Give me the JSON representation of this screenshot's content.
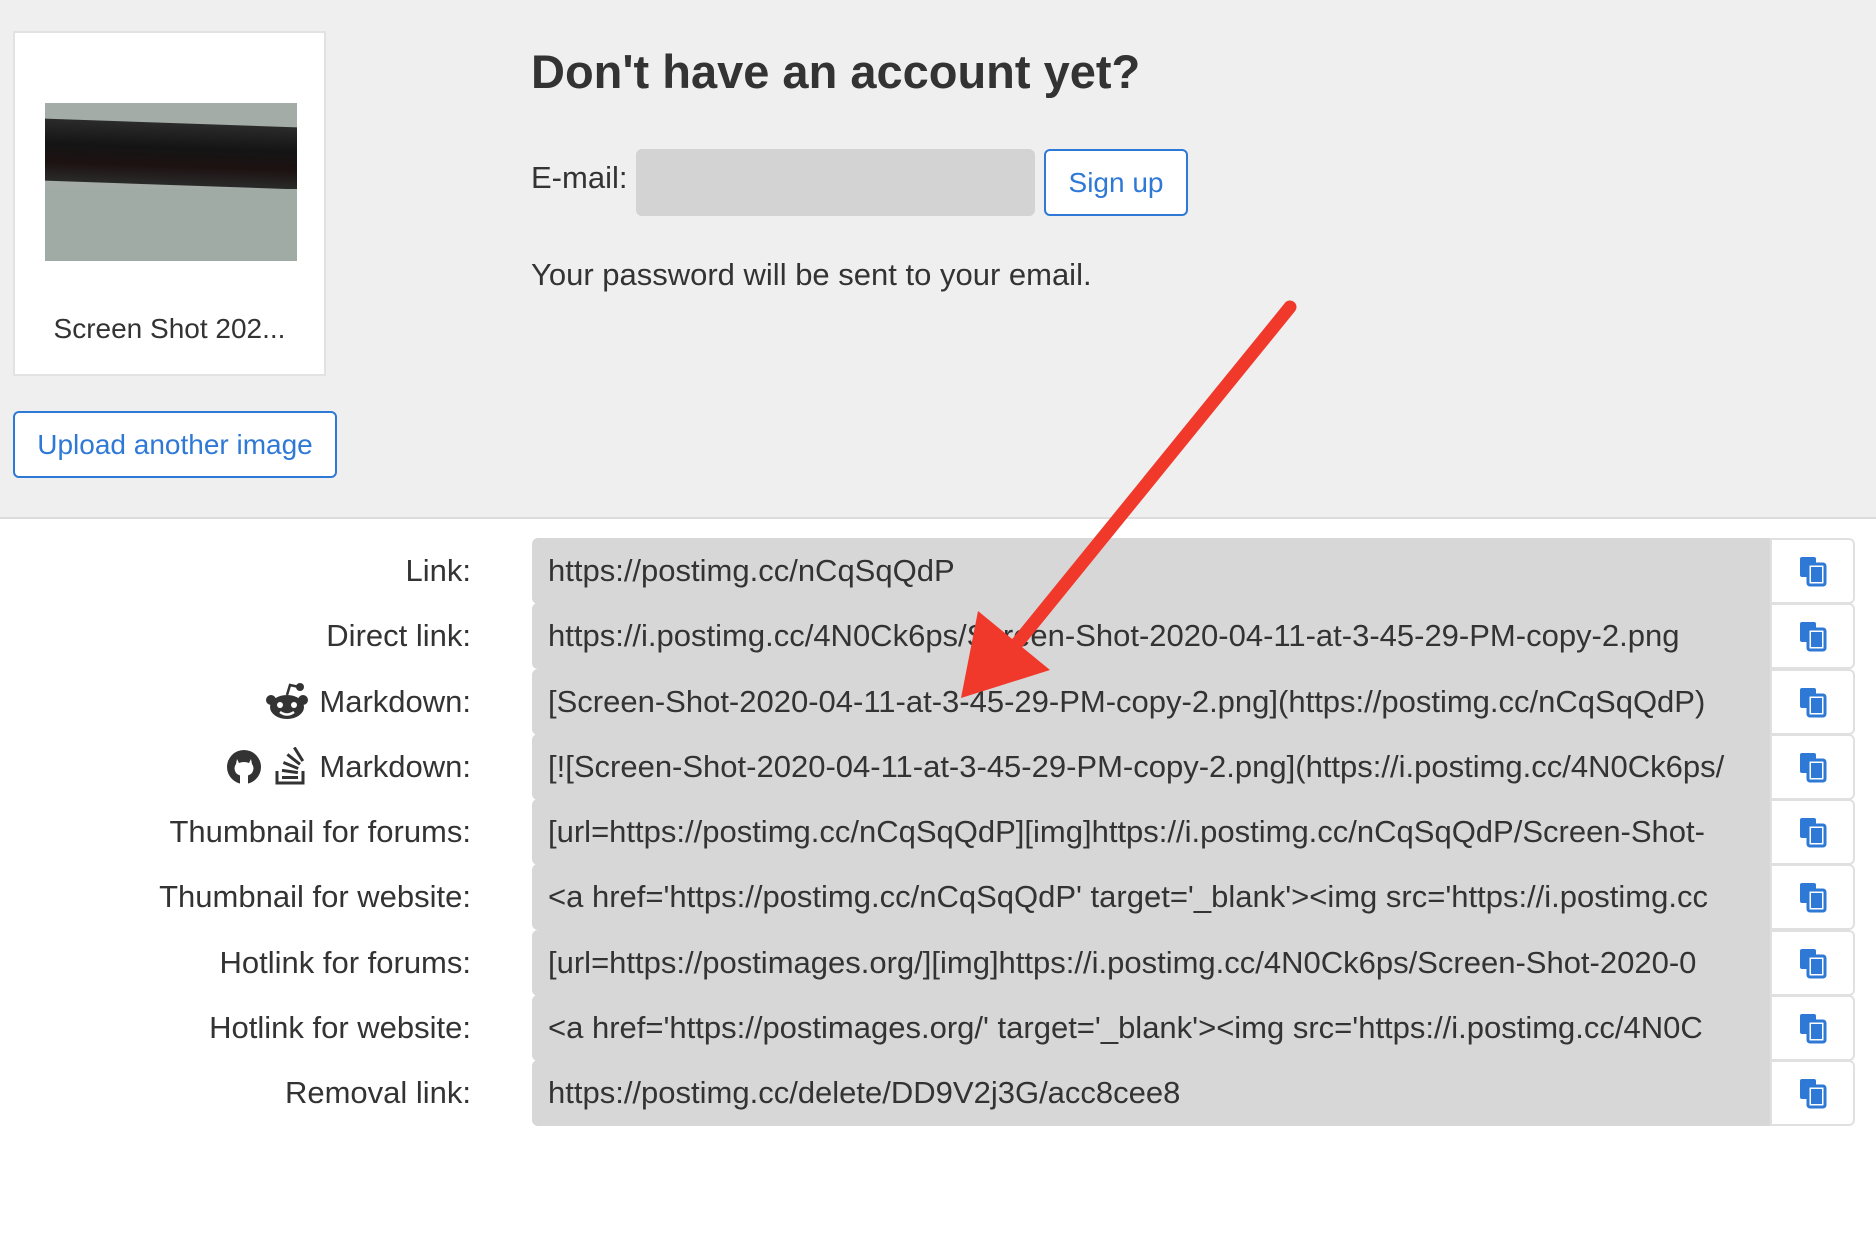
{
  "upload_panel": {
    "thumbnail_caption": "Screen Shot 202...",
    "upload_button_label": "Upload another image"
  },
  "signup": {
    "heading": "Don't have an account yet?",
    "email_label": "E-mail:",
    "email_value": "",
    "signup_button_label": "Sign up",
    "note": "Your password will be sent to your email."
  },
  "links": [
    {
      "label": "Link:",
      "value": "https://postimg.cc/nCqSqQdP",
      "icons": []
    },
    {
      "label": "Direct link:",
      "value": "https://i.postimg.cc/4N0Ck6ps/Screen-Shot-2020-04-11-at-3-45-29-PM-copy-2.png",
      "icons": []
    },
    {
      "label": "Markdown:",
      "value": "[Screen-Shot-2020-04-11-at-3-45-29-PM-copy-2.png](https://postimg.cc/nCqSqQdP)",
      "icons": [
        "reddit-icon"
      ]
    },
    {
      "label": "Markdown:",
      "value": "[![Screen-Shot-2020-04-11-at-3-45-29-PM-copy-2.png](https://i.postimg.cc/4N0Ck6ps/",
      "icons": [
        "github-icon",
        "stackoverflow-icon"
      ]
    },
    {
      "label": "Thumbnail for forums:",
      "value": "[url=https://postimg.cc/nCqSqQdP][img]https://i.postimg.cc/nCqSqQdP/Screen-Shot-",
      "icons": []
    },
    {
      "label": "Thumbnail for website:",
      "value": "<a href='https://postimg.cc/nCqSqQdP' target='_blank'><img src='https://i.postimg.cc",
      "icons": []
    },
    {
      "label": "Hotlink for forums:",
      "value": "[url=https://postimages.org/][img]https://i.postimg.cc/4N0Ck6ps/Screen-Shot-2020-0",
      "icons": []
    },
    {
      "label": "Hotlink for website:",
      "value": "<a href='https://postimages.org/' target='_blank'><img src='https://i.postimg.cc/4N0C",
      "icons": []
    },
    {
      "label": "Removal link:",
      "value": "https://postimg.cc/delete/DD9V2j3G/acc8cee8",
      "icons": []
    }
  ],
  "colors": {
    "accent": "#2f79d6",
    "annotation_arrow": "#f0392b",
    "field_background": "#d7d7d7",
    "panel_background": "#efefef"
  }
}
